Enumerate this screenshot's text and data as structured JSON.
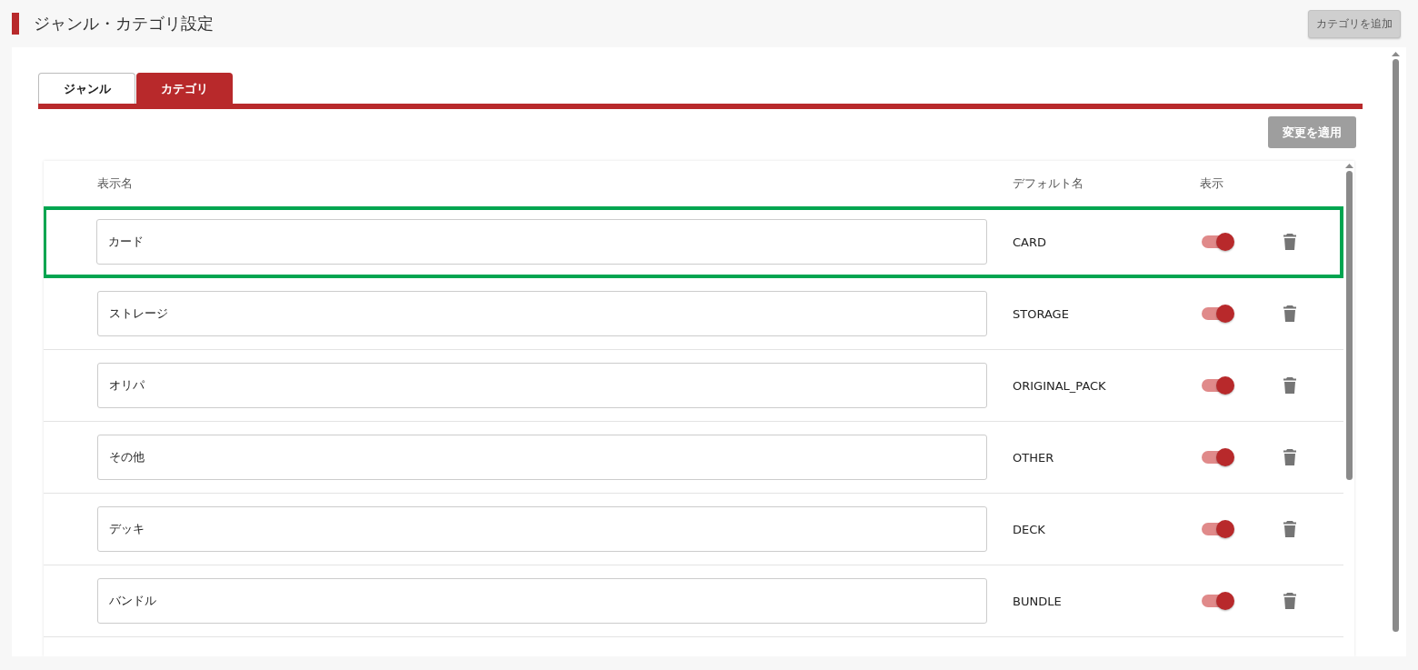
{
  "page": {
    "title": "ジャンル・カテゴリ設定",
    "add_button": "カテゴリを追加"
  },
  "tabs": [
    {
      "label": "ジャンル",
      "selected": false
    },
    {
      "label": "カテゴリ",
      "selected": true
    }
  ],
  "apply_button": "変更を適用",
  "table": {
    "columns": [
      "表示名",
      "デフォルト名",
      "表示"
    ],
    "rows": [
      {
        "display_name": "カード",
        "default_name": "CARD",
        "visible": true,
        "highlighted": true
      },
      {
        "display_name": "ストレージ",
        "default_name": "STORAGE",
        "visible": true,
        "highlighted": false
      },
      {
        "display_name": "オリパ",
        "default_name": "ORIGINAL_PACK",
        "visible": true,
        "highlighted": false
      },
      {
        "display_name": "その他",
        "default_name": "OTHER",
        "visible": true,
        "highlighted": false
      },
      {
        "display_name": "デッキ",
        "default_name": "DECK",
        "visible": true,
        "highlighted": false
      },
      {
        "display_name": "バンドル",
        "default_name": "BUNDLE",
        "visible": true,
        "highlighted": false
      }
    ]
  }
}
